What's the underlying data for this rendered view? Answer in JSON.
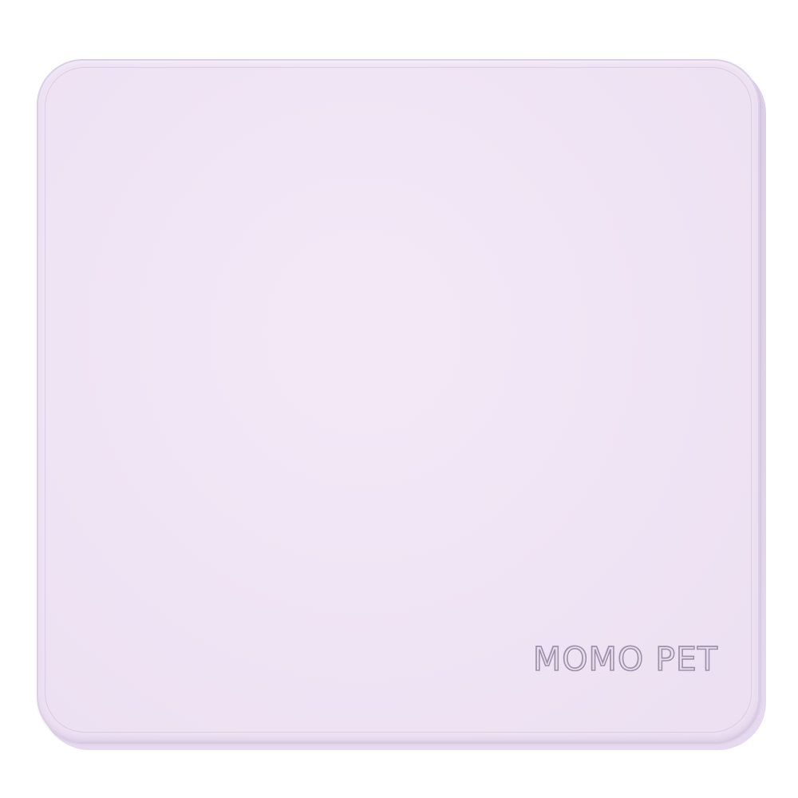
{
  "product": {
    "brand_text": "MOMO PET",
    "mat_color": "#efe4f4",
    "edge_color": "#ddd0e6",
    "embossed_text_color": "#9e90a8",
    "background_color": "#ffffff"
  }
}
